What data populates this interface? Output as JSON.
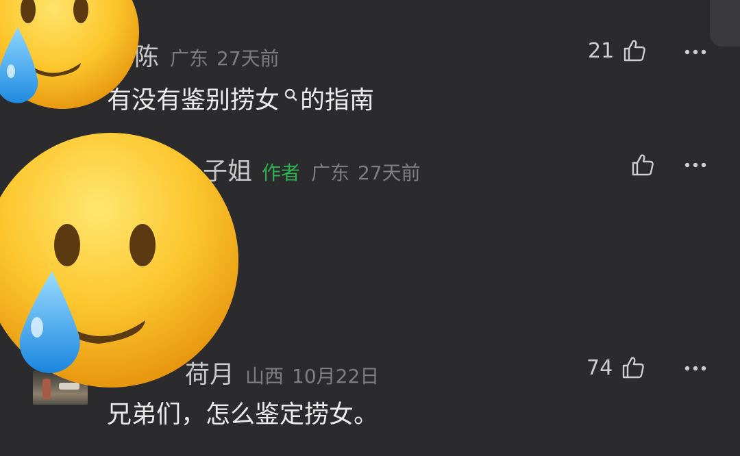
{
  "comments": [
    {
      "username": "陈",
      "location": "广东",
      "time": "27天前",
      "likes": "21",
      "text_before": "有没有鉴别捞女",
      "text_after": "的指南",
      "like_icon": "thumbs-up-icon",
      "more_icon": "more-dots-icon"
    },
    {
      "username": "子姐",
      "author_tag": "作者",
      "location": "广东",
      "time": "27天前",
      "likes": "",
      "like_icon": "thumbs-up-icon",
      "more_icon": "more-dots-icon"
    },
    {
      "username": "荷月",
      "location": "山西",
      "time": "10月22日",
      "likes": "74",
      "text": "兄弟们，怎么鉴定捞女。",
      "like_icon": "thumbs-up-icon",
      "more_icon": "more-dots-icon"
    }
  ],
  "colors": {
    "background": "#2b2b2d",
    "author_tag": "#2fb24f",
    "meta": "#7e7e80",
    "body_text": "#ececec"
  },
  "overlays": [
    "crying-smile-emoji",
    "crying-smile-emoji"
  ]
}
